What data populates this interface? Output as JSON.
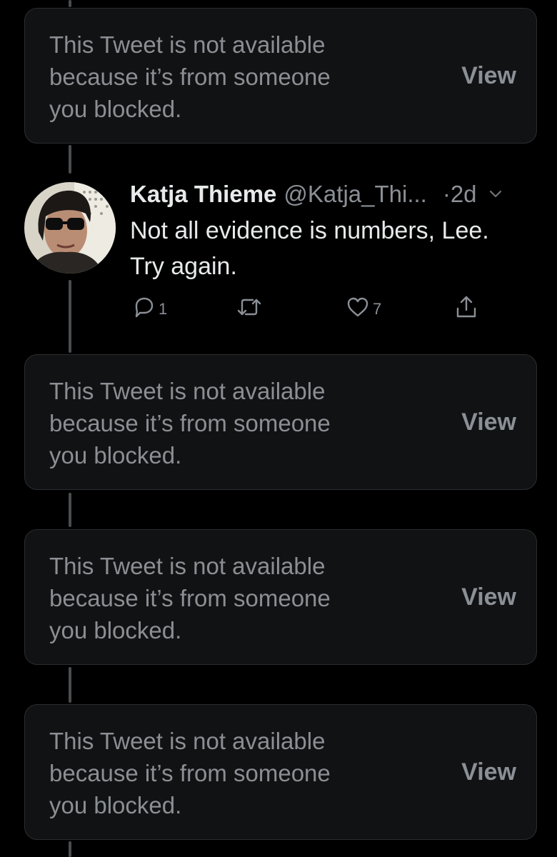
{
  "blocked_notice": {
    "message": "This Tweet is not available\nbecause it’s from someone\nyou blocked.",
    "view_label": "View"
  },
  "tweet": {
    "author_name": "Katja Thieme",
    "author_handle": "@Katja_Thi...",
    "time": "·2d",
    "text": "Not all evidence is numbers, Lee.\nTry again.",
    "reply_count": "1",
    "like_count": "7",
    "icons": {
      "reply": "reply-icon",
      "retweet": "retweet-icon",
      "like": "like-icon",
      "share": "share-icon",
      "more": "chevron-down-icon"
    }
  },
  "colors": {
    "background": "#000000",
    "card_background": "#111214",
    "card_border": "#2a2d30",
    "muted_text": "#8b9096",
    "primary_text": "#e7e9ea",
    "thread_line": "#4a4d50"
  }
}
